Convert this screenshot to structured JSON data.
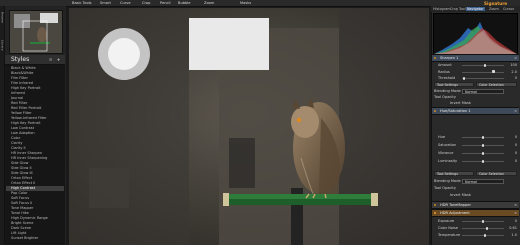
{
  "app": {
    "logo": "Signature"
  },
  "menu": [
    "Basic Tools",
    "Smart",
    "Curve",
    "Crop",
    "Pencil",
    "Bubble",
    "Zoom",
    "Masks"
  ],
  "left_tabs": [
    "Browse",
    "Library"
  ],
  "styles_panel": {
    "title": "Styles",
    "items": [
      "Black & White",
      "Black&White",
      "Film Filter",
      "Film Infrared",
      "High Key Portrait",
      "Infrared",
      "Journal",
      "Red Filter",
      "Red Filter Portrait",
      "Yellow Filter",
      "Yellow-Infrared Filter",
      "High Key Portrait",
      "Low Contrast",
      "Low Adaption",
      "Color",
      "Clarity",
      "Clarity II",
      "HR Inner Sharpen",
      "HR Inner Sharpening",
      "Side Glow",
      "Side Glow II",
      "Side Glow III",
      "Orton Effect",
      "Orton Effect II",
      "High Contrast",
      "Pop Color",
      "Soft Focus",
      "Soft Focus II",
      "Tone Mapper",
      "Tonal Hike",
      "High Dynamic Range",
      "Bright Scene",
      "Dark Scene",
      "Lift Light",
      "Sunset Brighter"
    ],
    "selected_index": 24
  },
  "right_tabs": [
    "Histogram",
    "Crop Tool",
    "Navigator",
    "Zoom",
    "Cursor"
  ],
  "right_active_tab": 2,
  "sections": {
    "sharpen": {
      "title": "Sharpen 1",
      "sliders": [
        {
          "label": "Amount",
          "value": "100"
        },
        {
          "label": "Radius",
          "value": "2.0"
        },
        {
          "label": "Threshold",
          "value": "0"
        }
      ],
      "tool_settings": "Tool Settings",
      "color_selection": "Color Selection",
      "blending_label": "Blending Mode",
      "blending_value": "Normal",
      "tool_opacity_label": "Tool Opacity",
      "invert_mask": "Invert Mask"
    },
    "huesat": {
      "title": "Hue/Saturation 1",
      "sliders": [
        {
          "label": "Hue",
          "value": "0"
        },
        {
          "label": "Saturation",
          "value": "0"
        },
        {
          "label": "Vibrance",
          "value": "0"
        },
        {
          "label": "Luminosity",
          "value": "0"
        }
      ],
      "tool_settings": "Tool Settings",
      "color_selection": "Color Selection",
      "blending_label": "Blending Mode",
      "blending_value": "Normal",
      "tool_opacity_label": "Tool Opacity",
      "invert_mask": "Invert Mask"
    },
    "tonemapper": {
      "title": "HDR ToneMapper"
    },
    "hdr_adjustment": {
      "title": "HDR Adjustment",
      "sliders": [
        {
          "label": "Exposure",
          "value": "0"
        },
        {
          "label": "Color Noise",
          "value": "0.61"
        },
        {
          "label": "Temperature",
          "value": "1.0"
        }
      ]
    }
  },
  "colors": {
    "accent": "#3b5f8c",
    "section_dot": "#d08a2c",
    "perch_green": "#2f7d3a"
  }
}
